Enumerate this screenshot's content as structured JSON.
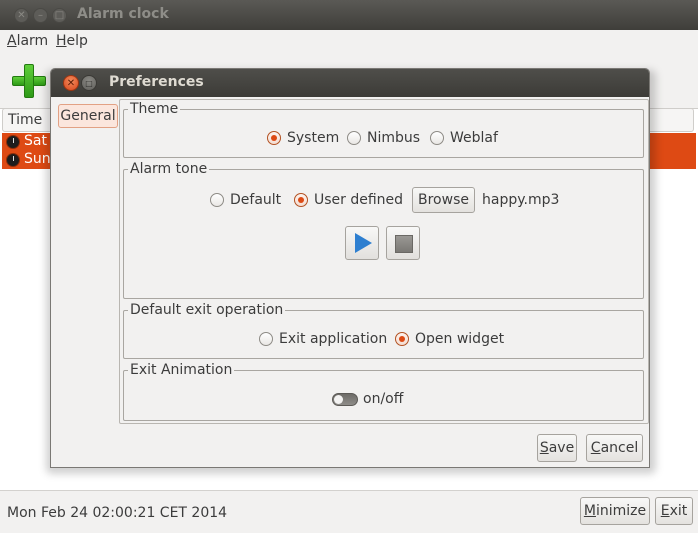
{
  "main_window": {
    "title": "Alarm clock",
    "menu": [
      {
        "mnemonic": "A",
        "rest": "larm"
      },
      {
        "mnemonic": "H",
        "rest": "elp"
      }
    ],
    "table": {
      "column_header": "Time",
      "rows": [
        {
          "label": "Sat"
        },
        {
          "label": "Sun"
        }
      ]
    },
    "status_text": "Mon Feb 24 02:00:21 CET 2014",
    "buttons": {
      "minimize": {
        "mnemonic": "M",
        "rest": "inimize"
      },
      "exit": {
        "mnemonic": "E",
        "rest": "xit"
      }
    },
    "row_highlight_color": "#de4a14"
  },
  "dialog": {
    "title": "Preferences",
    "tabs": [
      {
        "label": "General",
        "selected": true
      }
    ],
    "theme": {
      "legend": "Theme",
      "options": [
        "System",
        "Nimbus",
        "Weblaf"
      ],
      "selected": "System"
    },
    "alarm_tone": {
      "legend": "Alarm tone",
      "options": [
        "Default",
        "User defined"
      ],
      "selected": "User defined",
      "browse_label": "Browse",
      "file_name": "happy.mp3",
      "icons": [
        "play-icon",
        "stop-icon"
      ]
    },
    "exit_operation": {
      "legend": "Default exit operation",
      "options": [
        "Exit application",
        "Open widget"
      ],
      "selected": "Open widget"
    },
    "exit_animation": {
      "legend": "Exit Animation",
      "toggle_label": "on/off",
      "enabled": false
    },
    "buttons": {
      "save": {
        "mnemonic": "S",
        "rest": "ave"
      },
      "cancel": {
        "mnemonic": "C",
        "rest": "ancel"
      }
    },
    "accent_color": "#dd4a14"
  }
}
